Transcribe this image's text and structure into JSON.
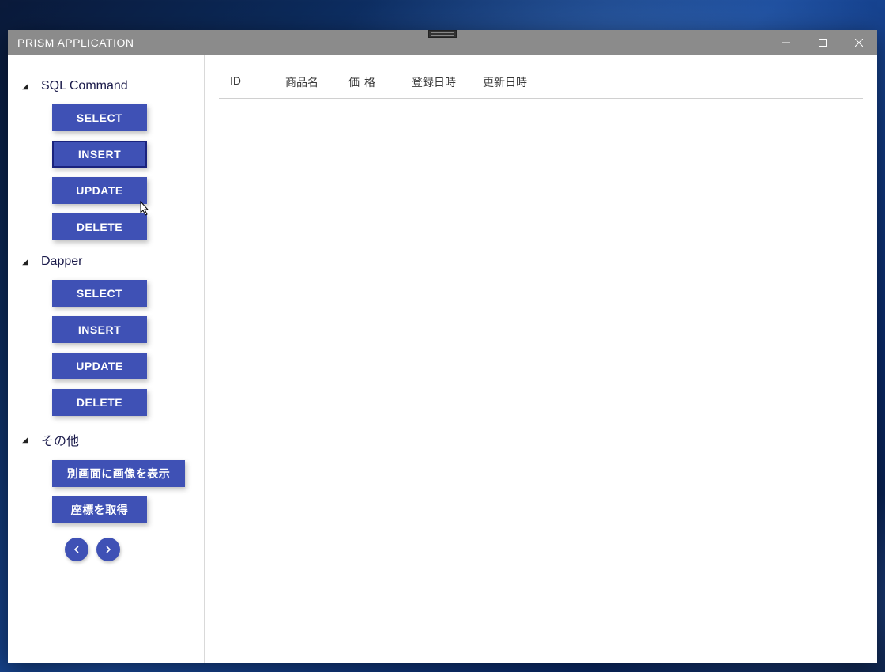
{
  "window": {
    "title": "PRISM APPLICATION"
  },
  "sidebar": {
    "groups": [
      {
        "title": "SQL Command",
        "buttons": [
          "SELECT",
          "INSERT",
          "UPDATE",
          "DELETE"
        ]
      },
      {
        "title": "Dapper",
        "buttons": [
          "SELECT",
          "INSERT",
          "UPDATE",
          "DELETE"
        ]
      },
      {
        "title": "その他",
        "buttons": [
          "別画面に画像を表示",
          "座標を取得"
        ]
      }
    ]
  },
  "grid": {
    "columns": {
      "id": "ID",
      "name": "商品名",
      "price": "価格",
      "created": "登録日時",
      "updated": "更新日時"
    }
  }
}
